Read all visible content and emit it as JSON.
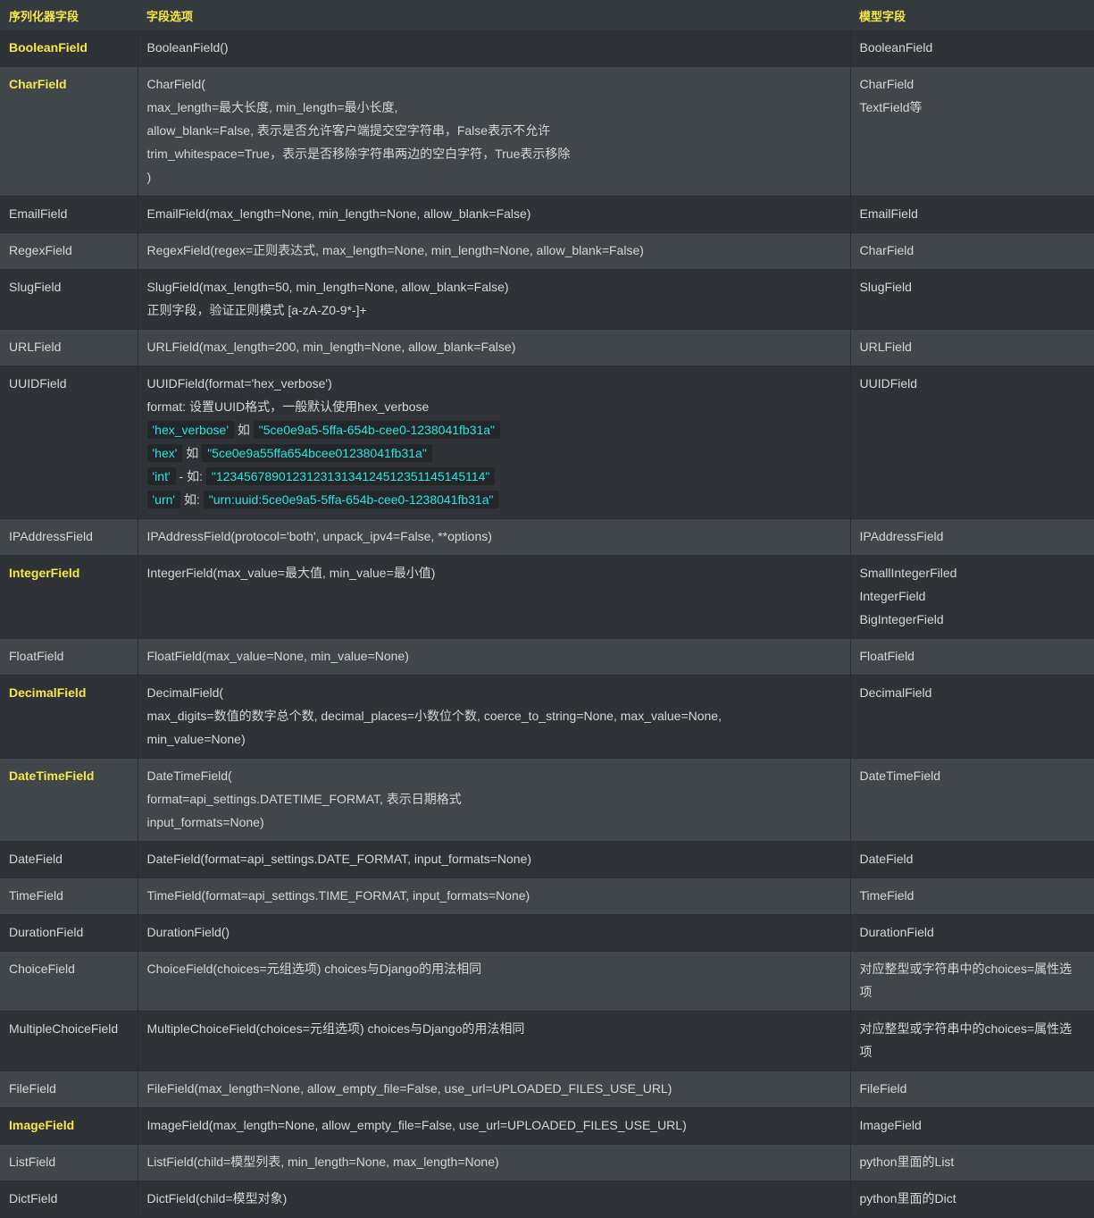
{
  "header": {
    "col1": "序列化器字段",
    "col2": "字段选项",
    "col3": "模型字段"
  },
  "rows": [
    {
      "name": "BooleanField",
      "highlight": true,
      "options": [
        "BooleanField()"
      ],
      "model": [
        "BooleanField"
      ]
    },
    {
      "name": "CharField",
      "highlight": true,
      "options": [
        "CharField(",
        "max_length=最大长度, min_length=最小长度,",
        "allow_blank=False, 表示是否允许客户端提交空字符串，False表示不允许",
        "trim_whitespace=True，表示是否移除字符串两边的空白字符，True表示移除",
        ")"
      ],
      "model": [
        "CharField",
        "TextField等"
      ]
    },
    {
      "name": "EmailField",
      "highlight": false,
      "options": [
        "EmailField(max_length=None, min_length=None, allow_blank=False)"
      ],
      "model": [
        "EmailField"
      ]
    },
    {
      "name": "RegexField",
      "highlight": false,
      "options": [
        "RegexField(regex=正则表达式, max_length=None, min_length=None, allow_blank=False)"
      ],
      "model": [
        "CharField"
      ]
    },
    {
      "name": "SlugField",
      "highlight": false,
      "options": [
        "SlugField(max_length=50, min_length=None, allow_blank=False)",
        "正则字段，验证正则模式 [a-zA-Z0-9*-]+"
      ],
      "model": [
        "SlugField"
      ]
    },
    {
      "name": "URLField",
      "highlight": false,
      "options": [
        "URLField(max_length=200, min_length=None, allow_blank=False)"
      ],
      "model": [
        "URLField"
      ]
    },
    {
      "name": "UUIDField",
      "highlight": false,
      "options": [
        "UUIDField(format='hex_verbose')",
        "format: 设置UUID格式，一般默认使用hex_verbose"
      ],
      "model": [
        "UUIDField"
      ]
    },
    {
      "name": "IPAddressField",
      "highlight": false,
      "options": [
        "IPAddressField(protocol='both', unpack_ipv4=False, **options)"
      ],
      "model": [
        "IPAddressField"
      ]
    },
    {
      "name": "IntegerField",
      "highlight": true,
      "options": [
        "IntegerField(max_value=最大值, min_value=最小值)"
      ],
      "model": [
        "SmallIntegerFiled",
        "IntegerField",
        "BigIntegerField"
      ]
    },
    {
      "name": "FloatField",
      "highlight": false,
      "options": [
        "FloatField(max_value=None, min_value=None)"
      ],
      "model": [
        "FloatField"
      ]
    },
    {
      "name": "DecimalField",
      "highlight": true,
      "options": [
        "DecimalField(",
        "max_digits=数值的数字总个数, decimal_places=小数位个数, coerce_to_string=None, max_value=None,",
        "min_value=None)"
      ],
      "model": [
        "DecimalField"
      ]
    },
    {
      "name": "DateTimeField",
      "highlight": true,
      "options": [
        "DateTimeField(",
        "format=api_settings.DATETIME_FORMAT, 表示日期格式",
        "input_formats=None)"
      ],
      "model": [
        "DateTimeField"
      ]
    },
    {
      "name": "DateField",
      "highlight": false,
      "options": [
        "DateField(format=api_settings.DATE_FORMAT, input_formats=None)"
      ],
      "model": [
        "DateField"
      ]
    },
    {
      "name": "TimeField",
      "highlight": false,
      "options": [
        "TimeField(format=api_settings.TIME_FORMAT, input_formats=None)"
      ],
      "model": [
        "TimeField"
      ]
    },
    {
      "name": "DurationField",
      "highlight": false,
      "options": [
        "DurationField()"
      ],
      "model": [
        "DurationField"
      ]
    },
    {
      "name": "ChoiceField",
      "highlight": false,
      "options": [
        "ChoiceField(choices=元组选项) choices与Django的用法相同"
      ],
      "model": [
        "对应整型或字符串中的choices=属性选",
        "项"
      ]
    },
    {
      "name": "MultipleChoiceField",
      "highlight": false,
      "options": [
        "MultipleChoiceField(choices=元组选项) choices与Django的用法相同"
      ],
      "model": [
        "对应整型或字符串中的choices=属性选",
        "项"
      ]
    },
    {
      "name": "FileField",
      "highlight": false,
      "options": [
        "FileField(max_length=None, allow_empty_file=False, use_url=UPLOADED_FILES_USE_URL)"
      ],
      "model": [
        "FileField"
      ]
    },
    {
      "name": "ImageField",
      "highlight": true,
      "options": [
        "ImageField(max_length=None, allow_empty_file=False, use_url=UPLOADED_FILES_USE_URL)"
      ],
      "model": [
        "ImageField"
      ]
    },
    {
      "name": "ListField",
      "highlight": false,
      "options": [
        "ListField(child=模型列表, min_length=None, max_length=None)"
      ],
      "model": [
        "python里面的List"
      ]
    },
    {
      "name": "DictField",
      "highlight": false,
      "options": [
        "DictField(child=模型对象)"
      ],
      "model": [
        "python里面的Dict"
      ]
    }
  ],
  "uuid_formats": [
    {
      "fmt": "'hex_verbose'",
      "sep": " 如 ",
      "example": "\"5ce0e9a5-5ffa-654b-cee0-1238041fb31a\""
    },
    {
      "fmt": "'hex'",
      "sep": " 如 ",
      "example": "\"5ce0e9a55ffa654bcee01238041fb31a\""
    },
    {
      "fmt": "'int'",
      "sep": " - 如: ",
      "example": "\"123456789012312313134124512351145145114\""
    },
    {
      "fmt": "'urn'",
      "sep": " 如: ",
      "example": "\"urn:uuid:5ce0e9a5-5ffa-654b-cee0-1238041fb31a\""
    }
  ],
  "colors": {
    "background": "#353a3f",
    "row_dark": "#2f3337",
    "row_light": "#41464b",
    "highlight_text": "#f5e84a",
    "code_text": "#2ee3e3",
    "code_bg": "#23272a"
  }
}
